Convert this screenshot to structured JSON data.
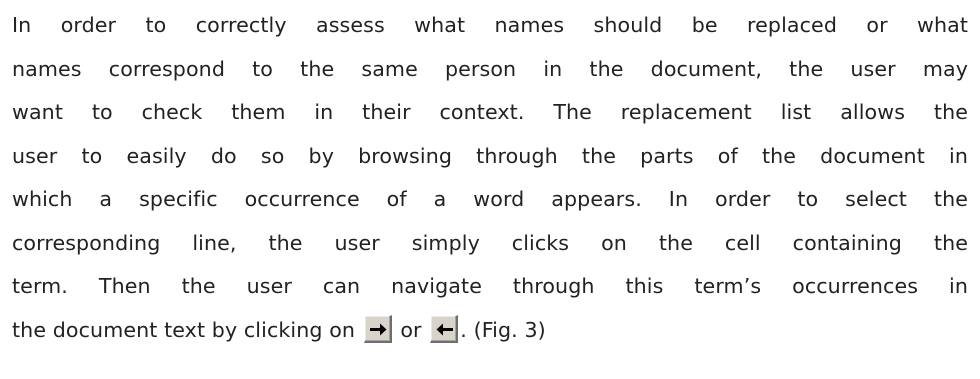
{
  "paragraph": {
    "lines": [
      "In order to correctly assess what names should be replaced or what",
      "names correspond to the same person in the document, the user may",
      "want to check them in their context. The replacement list allows the",
      "user to easily do so by browsing through the parts of the document in",
      "which a specific occurrence of a word appears. In order to select the",
      "corresponding line, the user simply clicks on the cell containing the",
      "term. Then the user can navigate through this term’s occurrences in"
    ],
    "last_line_before": "the document text by clicking on",
    "last_line_or": "or",
    "last_line_after": ". (Fig. 3)"
  },
  "icons": {
    "next_button": "arrow-right-icon",
    "previous_button": "arrow-left-icon"
  },
  "colors": {
    "text": "#222222",
    "button_face": "#d8d4cc"
  }
}
